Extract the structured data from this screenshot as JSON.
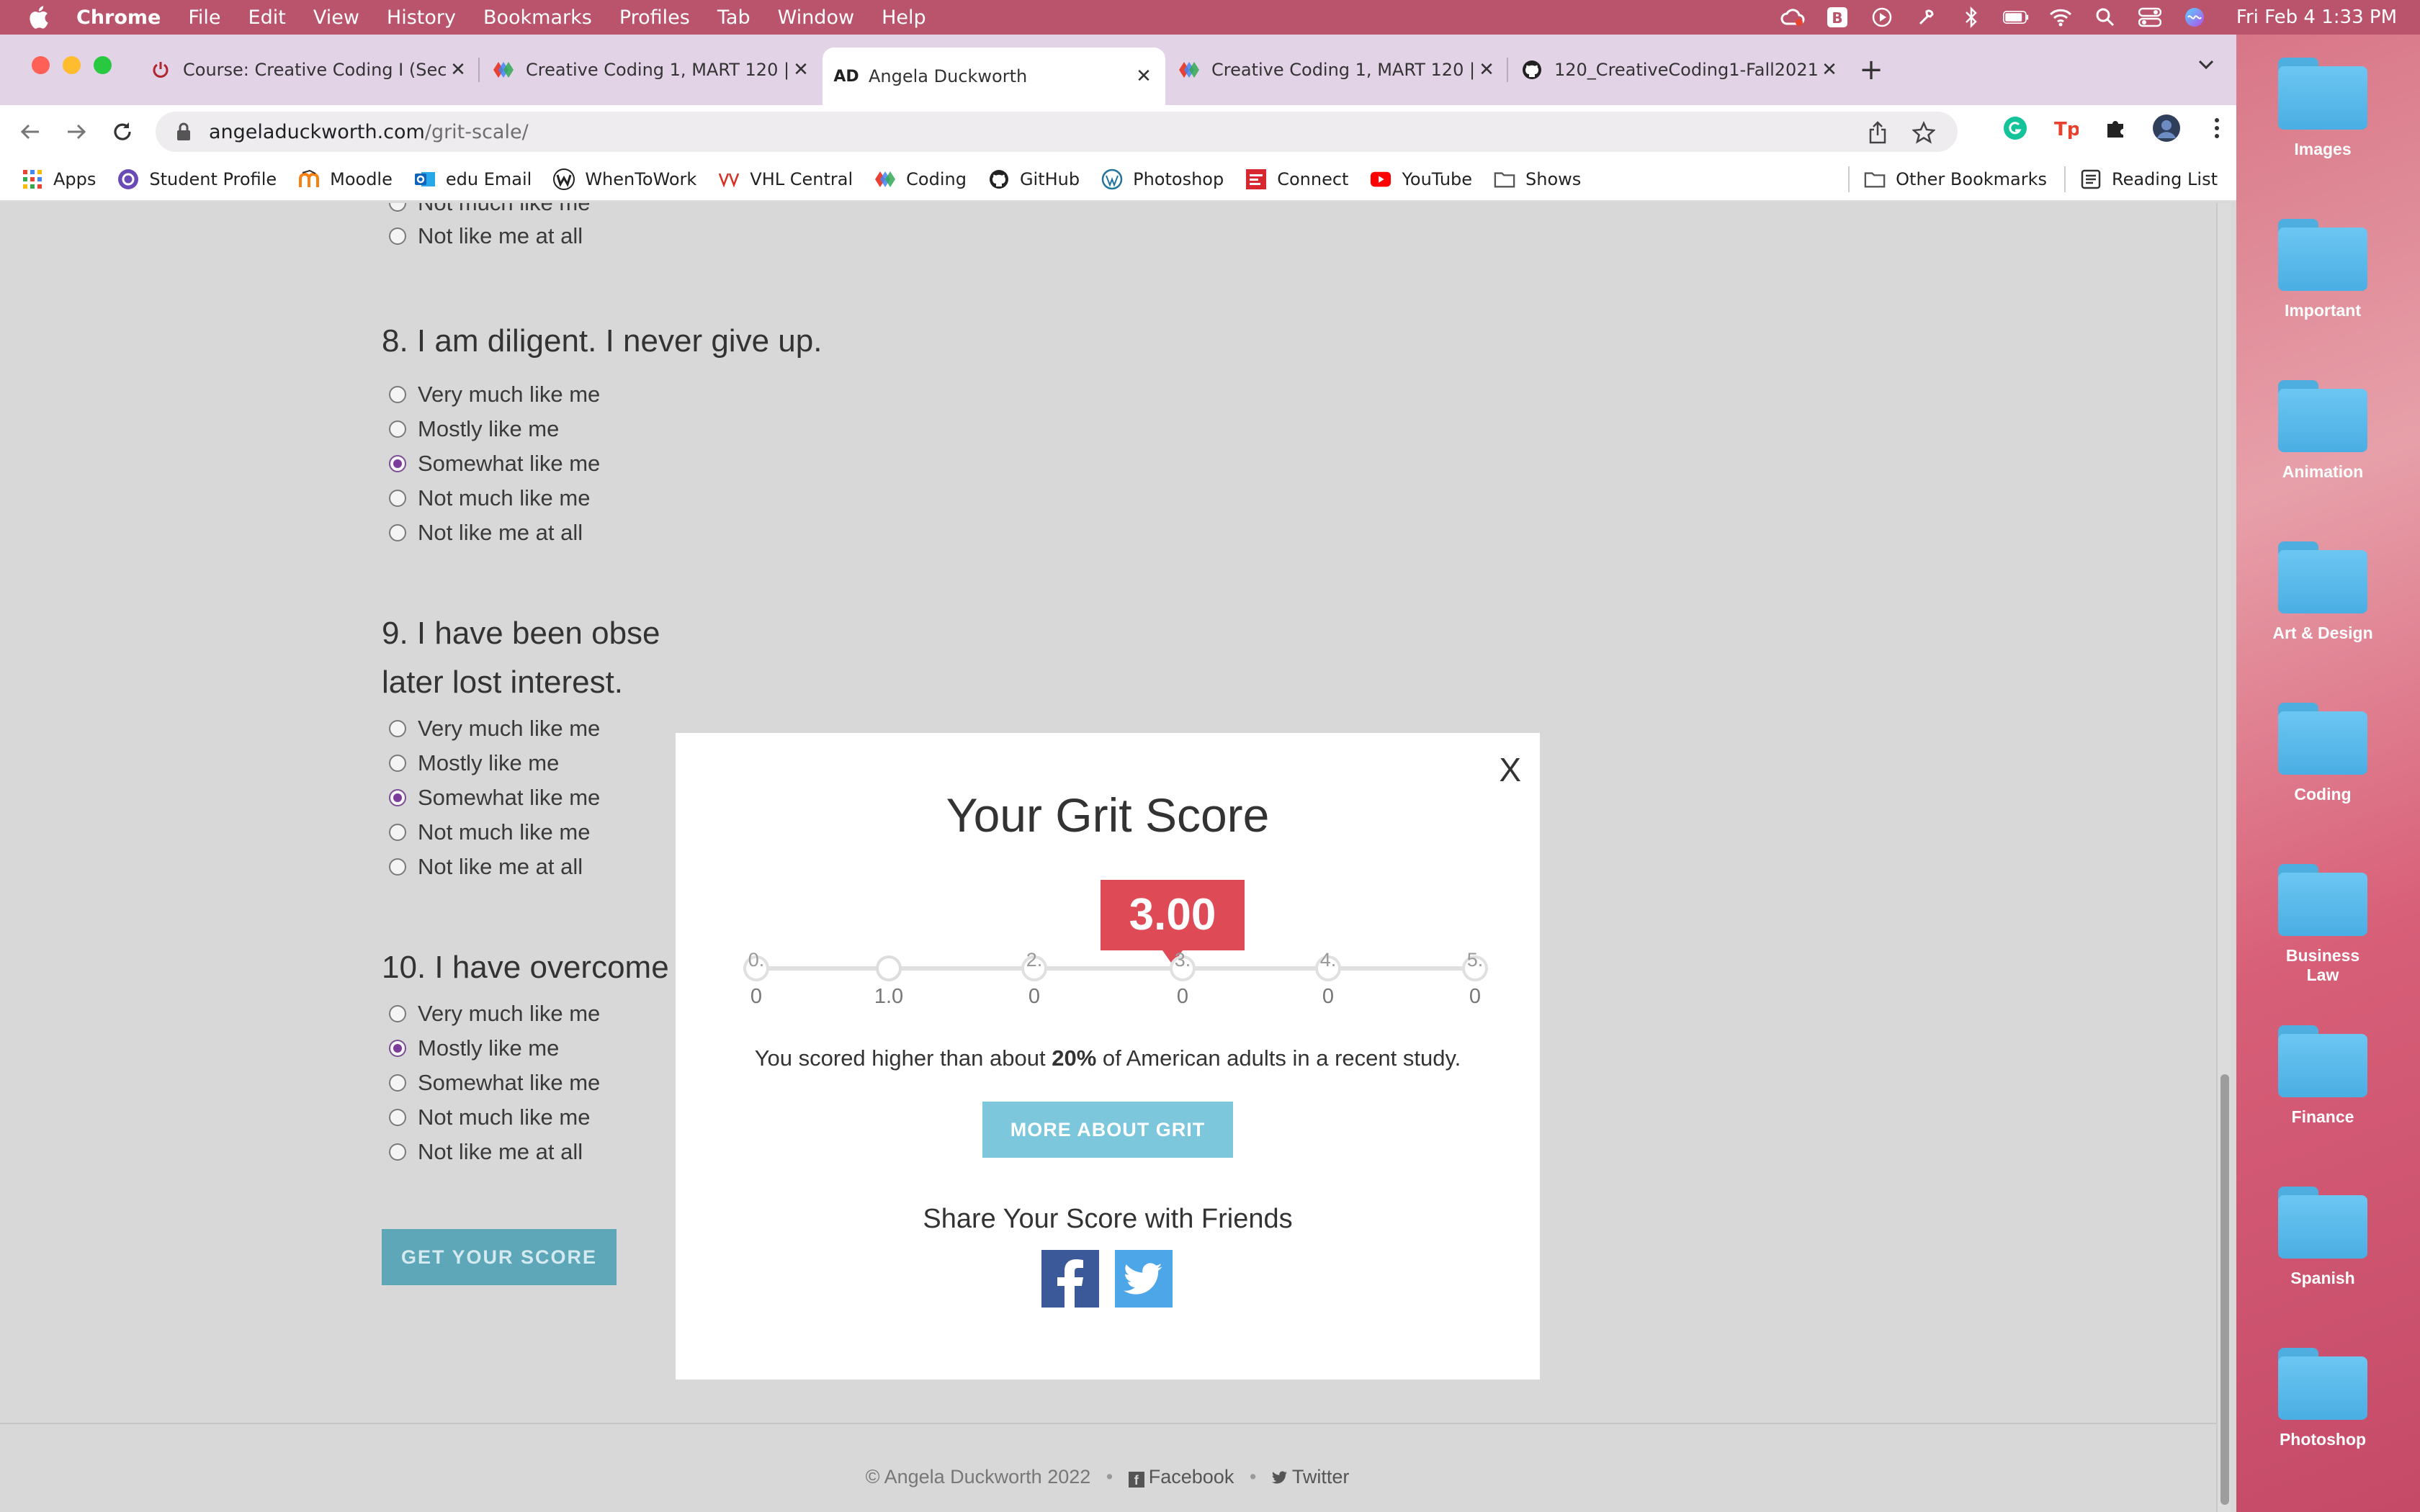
{
  "menubar": {
    "app_name": "Chrome",
    "items": [
      "File",
      "Edit",
      "View",
      "History",
      "Bookmarks",
      "Profiles",
      "Tab",
      "Window",
      "Help"
    ],
    "clock": "Fri Feb 4  1:33 PM"
  },
  "tabs": [
    {
      "title": "Course: Creative Coding I (Sec",
      "icon": "power-icon",
      "active": false
    },
    {
      "title": "Creative Coding 1, MART 120 |",
      "icon": "colored-diamonds-icon",
      "active": false
    },
    {
      "title": "Angela Duckworth",
      "icon": "ad-logo-icon",
      "icon_text": "AD",
      "active": true
    },
    {
      "title": "Creative Coding 1, MART 120 |",
      "icon": "colored-diamonds-icon",
      "active": false
    },
    {
      "title": "120_CreativeCoding1-Fall2021",
      "icon": "github-icon",
      "active": false
    }
  ],
  "address_bar": {
    "host": "angeladuckworth.com",
    "path": "/grit-scale/"
  },
  "bookmarks": [
    {
      "label": "Apps",
      "icon": "apps-grid-icon"
    },
    {
      "label": "Student Profile",
      "icon": "student-profile-icon"
    },
    {
      "label": "Moodle",
      "icon": "moodle-icon"
    },
    {
      "label": "edu Email",
      "icon": "outlook-icon"
    },
    {
      "label": "WhenToWork",
      "icon": "w-logo-icon"
    },
    {
      "label": "VHL Central",
      "icon": "vhl-icon"
    },
    {
      "label": "Coding",
      "icon": "colored-diamonds-icon"
    },
    {
      "label": "GitHub",
      "icon": "github-icon"
    },
    {
      "label": "Photoshop",
      "icon": "wordpress-icon"
    },
    {
      "label": "Connect",
      "icon": "mcgraw-hill-icon"
    },
    {
      "label": "YouTube",
      "icon": "youtube-icon"
    },
    {
      "label": "Shows",
      "icon": "folder-icon"
    }
  ],
  "bookmarks_right": {
    "other": "Other Bookmarks",
    "reading_list": "Reading List"
  },
  "page": {
    "partial_option": "Not much like me",
    "q7_last_option": "Not like me at all",
    "questions": [
      {
        "title": "8. I am diligent. I never give up.",
        "options": [
          "Very much like me",
          "Mostly like me",
          "Somewhat like me",
          "Not much like me",
          "Not like me at all"
        ],
        "selected": 2
      },
      {
        "title_line1": "9. I have been obse",
        "title_line2": "later lost interest.",
        "options": [
          "Very much like me",
          "Mostly like me",
          "Somewhat like me",
          "Not much like me",
          "Not like me at all"
        ],
        "selected": 2
      },
      {
        "title": "10. I have overcome",
        "options": [
          "Very much like me",
          "Mostly like me",
          "Somewhat like me",
          "Not much like me",
          "Not like me at all"
        ],
        "selected": 1
      }
    ],
    "get_score_button": "GET YOUR SCORE",
    "footer": {
      "copyright": "© Angela Duckworth 2022",
      "facebook": "Facebook",
      "twitter": "Twitter"
    }
  },
  "modal": {
    "close": "X",
    "title": "Your Grit Score",
    "score": "3.00",
    "scale": [
      {
        "top": "0.",
        "bottom": "0"
      },
      {
        "top": "",
        "bottom": "1.0"
      },
      {
        "top": "2.",
        "bottom": "0"
      },
      {
        "top": "3.",
        "bottom": "0"
      },
      {
        "top": "4.",
        "bottom": "0"
      },
      {
        "top": "5.",
        "bottom": "0"
      }
    ],
    "result_prefix": "You scored higher than about ",
    "result_percent": "20%",
    "result_suffix": " of American adults in a recent study.",
    "more_button": "MORE ABOUT GRIT",
    "share_title": "Share Your Score with Friends"
  },
  "desktop": {
    "folders": [
      "Images",
      "Important",
      "Animation",
      "Art & Design",
      "Coding",
      "Business Law",
      "Finance",
      "Spanish",
      "Photoshop"
    ]
  },
  "colors": {
    "accent_radio": "#7a3d99",
    "score_badge": "#df4a57",
    "more_button": "#7dc7dd",
    "facebook": "#3b5998",
    "twitter": "#4da6e8"
  }
}
